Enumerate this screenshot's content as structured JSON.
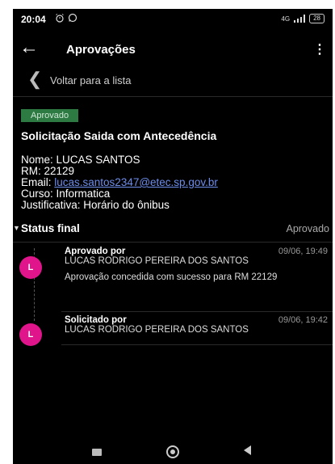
{
  "status_bar": {
    "time": "20:04",
    "network": "4G",
    "battery": "28",
    "icons": [
      "alarm-icon",
      "whatsapp-icon",
      "signal-icon",
      "battery-icon"
    ]
  },
  "app_bar": {
    "title": "Aprovações",
    "back_icon": "arrow-left-icon",
    "menu_icon": "kebab-menu-icon"
  },
  "back_link": {
    "label": "Voltar para a lista"
  },
  "request": {
    "badge": "Aprovado",
    "title": "Solicitação Saida com Antecedência",
    "fields": {
      "nome_label": "Nome: ",
      "nome": "LUCAS SANTOS",
      "rm_label": "RM: ",
      "rm": "22129",
      "email_label": "Email: ",
      "email": "lucas.santos2347@etec.sp.gov.br",
      "curso_label": "Curso: ",
      "curso": "Informatica",
      "justificativa_label": "Justificativa: ",
      "justificativa": "Horário do ônibus"
    }
  },
  "status_final": {
    "title": "Status final",
    "value": "Aprovado"
  },
  "timeline": [
    {
      "initial": "L",
      "label": "Aprovado por",
      "date": "09/06, 19:49",
      "name": "LUCAS RODRIGO PEREIRA DOS SANTOS",
      "message": "Aprovação concedida com sucesso para RM 22129"
    },
    {
      "initial": "L",
      "label": "Solicitado por",
      "date": "09/06, 19:42",
      "name": "LUCAS RODRIGO PEREIRA DOS SANTOS"
    }
  ],
  "colors": {
    "background": "#000000",
    "approved_badge": "#2e7a43",
    "avatar": "#e0148b",
    "link": "#6d8dea"
  }
}
